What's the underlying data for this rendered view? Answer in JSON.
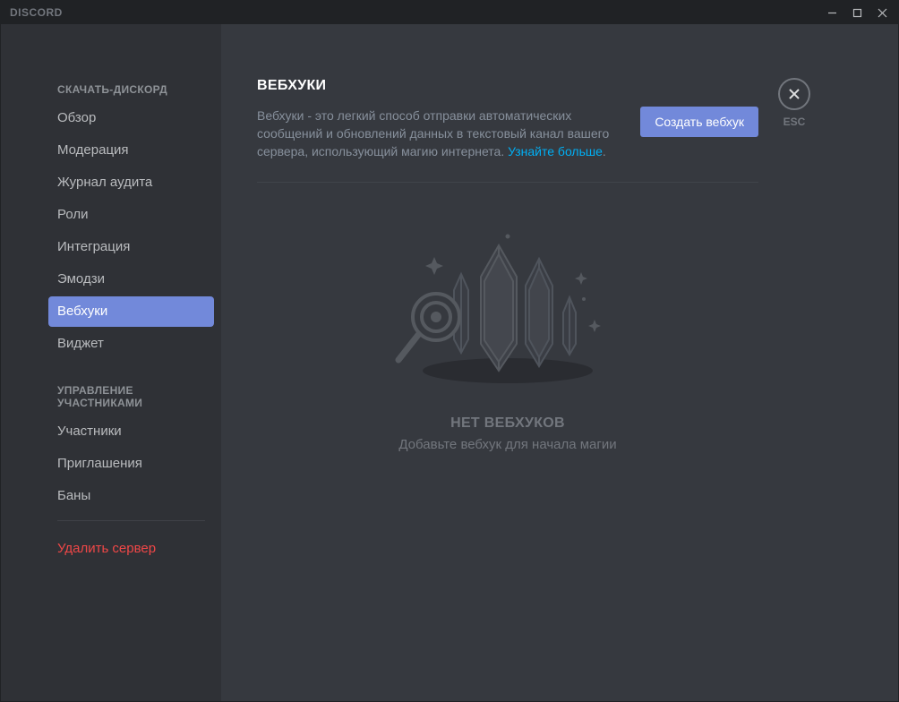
{
  "titlebar": {
    "app_name": "DISCORD"
  },
  "sidebar": {
    "section1_header": "СКАЧАТЬ-ДИСКОРД",
    "items1": [
      {
        "label": "Обзор"
      },
      {
        "label": "Модерация"
      },
      {
        "label": "Журнал аудита"
      },
      {
        "label": "Роли"
      },
      {
        "label": "Интеграция"
      },
      {
        "label": "Эмодзи"
      },
      {
        "label": "Вебхуки"
      },
      {
        "label": "Виджет"
      }
    ],
    "section2_header": "УПРАВЛЕНИЕ УЧАСТНИКАМИ",
    "items2": [
      {
        "label": "Участники"
      },
      {
        "label": "Приглашения"
      },
      {
        "label": "Баны"
      }
    ],
    "delete_label": "Удалить сервер"
  },
  "main": {
    "title": "ВЕБХУКИ",
    "description_part1": "Вебхуки - это легкий способ отправки автоматических сообщений и обновлений данных в текстовый канал вашего сервера, использующий магию интернета. ",
    "description_link": "Узнайте больше",
    "description_part2": ".",
    "create_button": "Создать вебхук",
    "empty_title": "НЕТ ВЕБХУКОВ",
    "empty_subtitle": "Добавьте вебхук для начала магии"
  },
  "close": {
    "esc_label": "ESC"
  }
}
